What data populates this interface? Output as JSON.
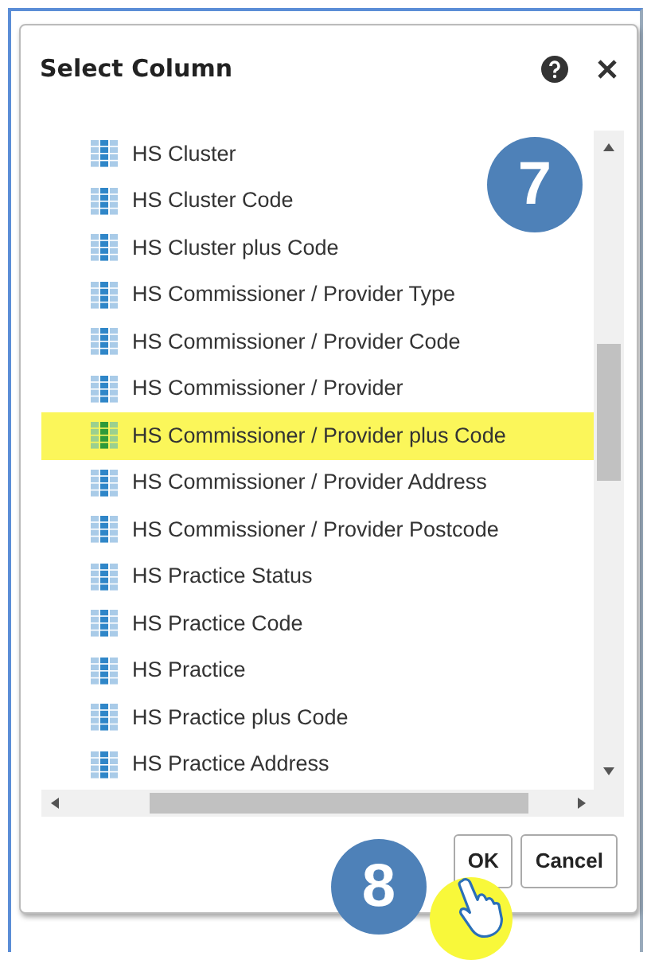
{
  "dialog": {
    "title": "Select Column"
  },
  "items": [
    {
      "label": "HS Cluster",
      "selected": false
    },
    {
      "label": "HS Cluster Code",
      "selected": false
    },
    {
      "label": "HS Cluster plus Code",
      "selected": false
    },
    {
      "label": "HS Commissioner / Provider Type",
      "selected": false
    },
    {
      "label": "HS Commissioner / Provider Code",
      "selected": false
    },
    {
      "label": "HS Commissioner / Provider",
      "selected": false
    },
    {
      "label": "HS Commissioner / Provider plus Code",
      "selected": true
    },
    {
      "label": "HS Commissioner / Provider Address",
      "selected": false
    },
    {
      "label": "HS Commissioner / Provider Postcode",
      "selected": false
    },
    {
      "label": "HS Practice Status",
      "selected": false
    },
    {
      "label": "HS Practice Code",
      "selected": false
    },
    {
      "label": "HS Practice",
      "selected": false
    },
    {
      "label": "HS Practice plus Code",
      "selected": false
    },
    {
      "label": "HS Practice Address",
      "selected": false
    }
  ],
  "buttons": [
    {
      "label": "OK"
    },
    {
      "label": "Cancel"
    }
  ],
  "step_badges": [
    {
      "label": "7"
    },
    {
      "label": "8"
    }
  ]
}
